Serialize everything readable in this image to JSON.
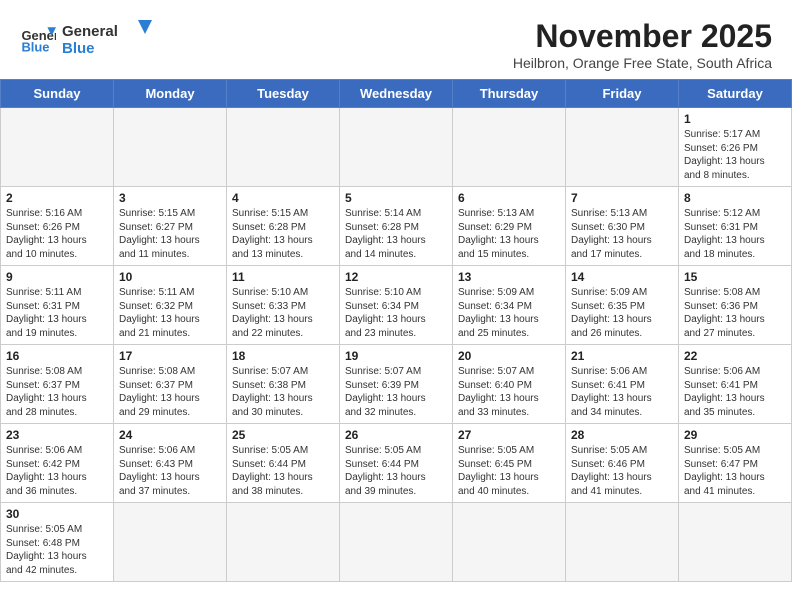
{
  "logo": {
    "text_general": "General",
    "text_blue": "Blue"
  },
  "header": {
    "month_title": "November 2025",
    "subtitle": "Heilbron, Orange Free State, South Africa"
  },
  "weekdays": [
    "Sunday",
    "Monday",
    "Tuesday",
    "Wednesday",
    "Thursday",
    "Friday",
    "Saturday"
  ],
  "weeks": [
    [
      {
        "day": "",
        "info": ""
      },
      {
        "day": "",
        "info": ""
      },
      {
        "day": "",
        "info": ""
      },
      {
        "day": "",
        "info": ""
      },
      {
        "day": "",
        "info": ""
      },
      {
        "day": "",
        "info": ""
      },
      {
        "day": "1",
        "info": "Sunrise: 5:17 AM\nSunset: 6:26 PM\nDaylight: 13 hours\nand 8 minutes."
      }
    ],
    [
      {
        "day": "2",
        "info": "Sunrise: 5:16 AM\nSunset: 6:26 PM\nDaylight: 13 hours\nand 10 minutes."
      },
      {
        "day": "3",
        "info": "Sunrise: 5:15 AM\nSunset: 6:27 PM\nDaylight: 13 hours\nand 11 minutes."
      },
      {
        "day": "4",
        "info": "Sunrise: 5:15 AM\nSunset: 6:28 PM\nDaylight: 13 hours\nand 13 minutes."
      },
      {
        "day": "5",
        "info": "Sunrise: 5:14 AM\nSunset: 6:28 PM\nDaylight: 13 hours\nand 14 minutes."
      },
      {
        "day": "6",
        "info": "Sunrise: 5:13 AM\nSunset: 6:29 PM\nDaylight: 13 hours\nand 15 minutes."
      },
      {
        "day": "7",
        "info": "Sunrise: 5:13 AM\nSunset: 6:30 PM\nDaylight: 13 hours\nand 17 minutes."
      },
      {
        "day": "8",
        "info": "Sunrise: 5:12 AM\nSunset: 6:31 PM\nDaylight: 13 hours\nand 18 minutes."
      }
    ],
    [
      {
        "day": "9",
        "info": "Sunrise: 5:11 AM\nSunset: 6:31 PM\nDaylight: 13 hours\nand 19 minutes."
      },
      {
        "day": "10",
        "info": "Sunrise: 5:11 AM\nSunset: 6:32 PM\nDaylight: 13 hours\nand 21 minutes."
      },
      {
        "day": "11",
        "info": "Sunrise: 5:10 AM\nSunset: 6:33 PM\nDaylight: 13 hours\nand 22 minutes."
      },
      {
        "day": "12",
        "info": "Sunrise: 5:10 AM\nSunset: 6:34 PM\nDaylight: 13 hours\nand 23 minutes."
      },
      {
        "day": "13",
        "info": "Sunrise: 5:09 AM\nSunset: 6:34 PM\nDaylight: 13 hours\nand 25 minutes."
      },
      {
        "day": "14",
        "info": "Sunrise: 5:09 AM\nSunset: 6:35 PM\nDaylight: 13 hours\nand 26 minutes."
      },
      {
        "day": "15",
        "info": "Sunrise: 5:08 AM\nSunset: 6:36 PM\nDaylight: 13 hours\nand 27 minutes."
      }
    ],
    [
      {
        "day": "16",
        "info": "Sunrise: 5:08 AM\nSunset: 6:37 PM\nDaylight: 13 hours\nand 28 minutes."
      },
      {
        "day": "17",
        "info": "Sunrise: 5:08 AM\nSunset: 6:37 PM\nDaylight: 13 hours\nand 29 minutes."
      },
      {
        "day": "18",
        "info": "Sunrise: 5:07 AM\nSunset: 6:38 PM\nDaylight: 13 hours\nand 30 minutes."
      },
      {
        "day": "19",
        "info": "Sunrise: 5:07 AM\nSunset: 6:39 PM\nDaylight: 13 hours\nand 32 minutes."
      },
      {
        "day": "20",
        "info": "Sunrise: 5:07 AM\nSunset: 6:40 PM\nDaylight: 13 hours\nand 33 minutes."
      },
      {
        "day": "21",
        "info": "Sunrise: 5:06 AM\nSunset: 6:41 PM\nDaylight: 13 hours\nand 34 minutes."
      },
      {
        "day": "22",
        "info": "Sunrise: 5:06 AM\nSunset: 6:41 PM\nDaylight: 13 hours\nand 35 minutes."
      }
    ],
    [
      {
        "day": "23",
        "info": "Sunrise: 5:06 AM\nSunset: 6:42 PM\nDaylight: 13 hours\nand 36 minutes."
      },
      {
        "day": "24",
        "info": "Sunrise: 5:06 AM\nSunset: 6:43 PM\nDaylight: 13 hours\nand 37 minutes."
      },
      {
        "day": "25",
        "info": "Sunrise: 5:05 AM\nSunset: 6:44 PM\nDaylight: 13 hours\nand 38 minutes."
      },
      {
        "day": "26",
        "info": "Sunrise: 5:05 AM\nSunset: 6:44 PM\nDaylight: 13 hours\nand 39 minutes."
      },
      {
        "day": "27",
        "info": "Sunrise: 5:05 AM\nSunset: 6:45 PM\nDaylight: 13 hours\nand 40 minutes."
      },
      {
        "day": "28",
        "info": "Sunrise: 5:05 AM\nSunset: 6:46 PM\nDaylight: 13 hours\nand 41 minutes."
      },
      {
        "day": "29",
        "info": "Sunrise: 5:05 AM\nSunset: 6:47 PM\nDaylight: 13 hours\nand 41 minutes."
      }
    ],
    [
      {
        "day": "30",
        "info": "Sunrise: 5:05 AM\nSunset: 6:48 PM\nDaylight: 13 hours\nand 42 minutes."
      },
      {
        "day": "",
        "info": ""
      },
      {
        "day": "",
        "info": ""
      },
      {
        "day": "",
        "info": ""
      },
      {
        "day": "",
        "info": ""
      },
      {
        "day": "",
        "info": ""
      },
      {
        "day": "",
        "info": ""
      }
    ]
  ]
}
